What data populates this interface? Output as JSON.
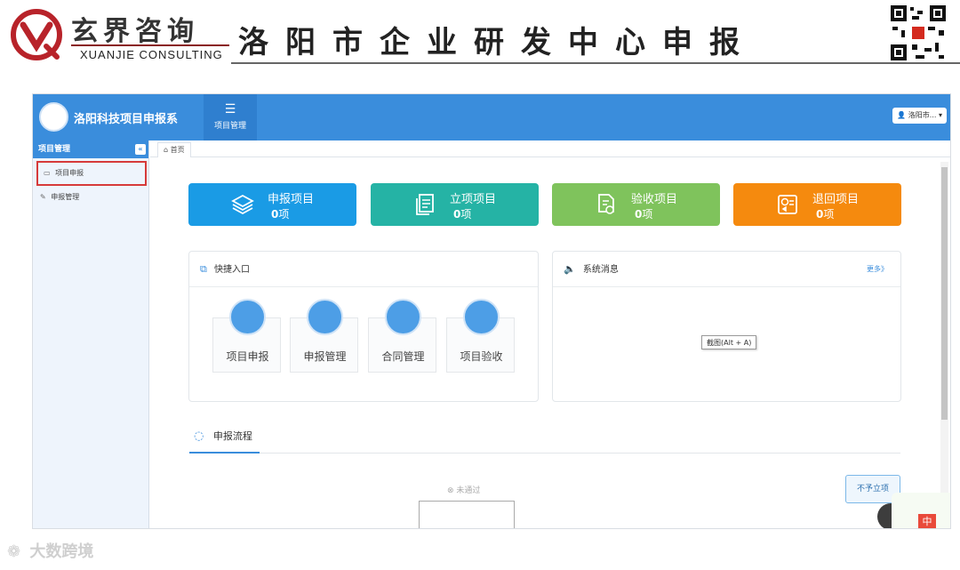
{
  "slide": {
    "brand_cn": "玄界咨询",
    "brand_en": "XUANJIE CONSULTING",
    "title": "洛阳市企业研发中心申报"
  },
  "app": {
    "system_title": "洛阳科技项目申报系",
    "top_nav": {
      "label": "项目管理",
      "icon": "list-icon"
    },
    "user_menu": "洛阳市..."
  },
  "sidebar": {
    "header": "项目管理",
    "collapse_symbol": "«",
    "items": [
      {
        "label": "项目申报",
        "icon": "monitor-icon",
        "highlighted": true
      },
      {
        "label": "申报管理",
        "icon": "pencil-icon",
        "highlighted": false
      }
    ]
  },
  "tabs": {
    "home": "首页"
  },
  "stats": [
    {
      "label": "申报项目",
      "count": "0",
      "unit": "项",
      "color": "#1a9be5",
      "icon": "layers-icon"
    },
    {
      "label": "立项项目",
      "count": "0",
      "unit": "项",
      "color": "#25b3a5",
      "icon": "documents-icon"
    },
    {
      "label": "验收项目",
      "count": "0",
      "unit": "项",
      "color": "#7fc35c",
      "icon": "file-check-icon"
    },
    {
      "label": "退回项目",
      "count": "0",
      "unit": "项",
      "color": "#f58a0e",
      "icon": "return-icon"
    }
  ],
  "quick_entry": {
    "title": "快捷入口",
    "items": [
      {
        "label": "项目申报",
        "icon": "apply-doc-icon"
      },
      {
        "label": "申报管理",
        "icon": "copy-icon"
      },
      {
        "label": "合同管理",
        "icon": "wrench-icon"
      },
      {
        "label": "项目验收",
        "icon": "inbox-icon"
      }
    ]
  },
  "messages": {
    "title": "系统消息",
    "more": "更多》",
    "tooltip": "截图(Alt + A)"
  },
  "flow": {
    "title": "申报流程",
    "not_passed": "未通过",
    "reject_button": "不予立项"
  },
  "badge": "中",
  "watermark": "大数跨境"
}
